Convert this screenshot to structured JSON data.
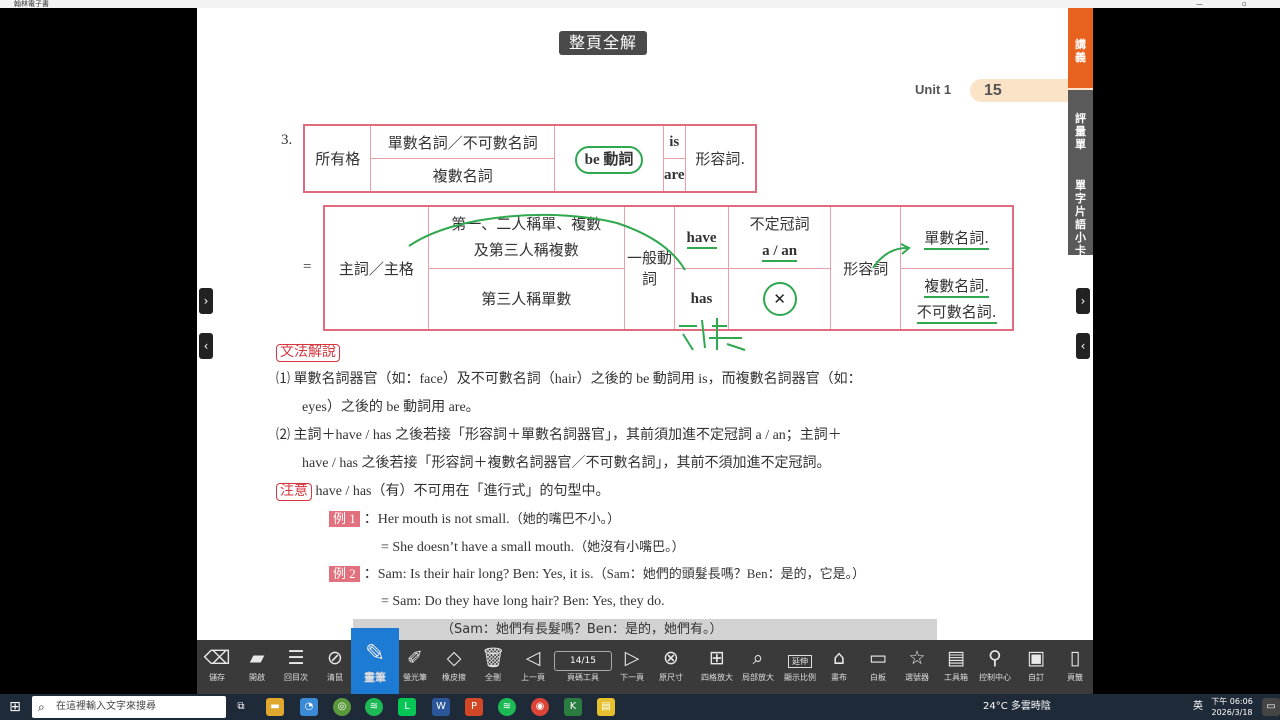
{
  "window": {
    "title": "翰林電子書"
  },
  "page": {
    "full_solution_label": "整頁全解",
    "unit_label": "Unit 1",
    "page_number": "15"
  },
  "side_tabs": {
    "handout": "講義",
    "evaluation": "評量單",
    "cards": "單字片語小卡"
  },
  "table1": {
    "number": "3.",
    "subject": "所有格",
    "row1": "單數名詞／不可數名詞",
    "row2": "複數名詞",
    "be_verb": "be 動詞",
    "is": "is",
    "are": "are",
    "adjective": "形容詞."
  },
  "table2": {
    "equals": "=",
    "subject": "主詞／主格",
    "group1_line1": "第一、二人稱單、複數",
    "group1_line2": "及第三人稱複數",
    "group2": "第三人稱單數",
    "general_verb": "一般動詞",
    "have": "have",
    "has": "has",
    "indef_header": "不定冠詞",
    "a_an": "a / an",
    "cross": "✕",
    "adjective": "形容詞",
    "singular_noun": "單數名詞.",
    "plural_noun": "複數名詞.",
    "uncountable_noun": "不可數名詞."
  },
  "explanation": {
    "tag": "文法解說",
    "p1_num": "⑴",
    "p1_line1": "單數名詞器官（如：face）及不可數名詞（hair）之後的 be 動詞用 is，而複數名詞器官（如：",
    "p1_line2": "eyes）之後的 be 動詞用 are。",
    "p2_num": "⑵",
    "p2_line1": "主詞＋have / has 之後若接「形容詞＋單數名詞器官」，其前須加進不定冠詞 a / an；主詞＋",
    "p2_line2": "have / has 之後若接「形容詞＋複數名詞器官／不可數名詞」，其前不須加進不定冠詞。"
  },
  "note": {
    "tag": "注意",
    "text": "have / has（有）不可用在「進行式」的句型中。"
  },
  "examples": [
    {
      "tag": "例 1",
      "en": "：Her mouth is not small.",
      "zh": "（她的嘴巴不小。）"
    },
    {
      "tag": "",
      "en": "= She doesn’t have a small mouth.",
      "zh": "（她沒有小嘴巴。）"
    },
    {
      "tag": "例 2",
      "en": "：Sam: Is their hair long?  Ben: Yes, it is.",
      "zh": "（Sam：她們的頭髮長嗎？Ben：是的，它是。）"
    },
    {
      "tag": "",
      "en": "= Sam: Do they have long hair?  Ben: Yes, they do.",
      "zh": ""
    }
  ],
  "overlay_text": "（Sam：她們有長髮嗎？Ben：是的，她們有。）",
  "toolbar": {
    "items": [
      {
        "label": "儲存",
        "icon": "eraser-icon"
      },
      {
        "label": "開啟",
        "icon": "folder-icon"
      },
      {
        "label": "回目次",
        "icon": "list-icon"
      },
      {
        "label": "清鼠",
        "icon": "clear-icon"
      },
      {
        "label": "畫筆",
        "icon": "pen-icon"
      },
      {
        "label": "螢光筆",
        "icon": "highlighter-icon"
      },
      {
        "label": "橡皮擦",
        "icon": "eraser-icon"
      },
      {
        "label": "全刪",
        "icon": "trash-icon"
      },
      {
        "label": "上一頁",
        "icon": "prev-icon"
      },
      {
        "label": "頁碼工具",
        "icon": "page-icon"
      },
      {
        "label": "下一頁",
        "icon": "next-icon"
      },
      {
        "label": "原尺寸",
        "icon": "zoom-reset-icon"
      },
      {
        "label": "四格放大",
        "icon": "grid-icon"
      },
      {
        "label": "局部放大",
        "icon": "zoom-area-icon"
      },
      {
        "label": "顯示比例",
        "icon": "ratio-icon"
      },
      {
        "label": "畫布",
        "icon": "canvas-icon"
      },
      {
        "label": "白板",
        "icon": "whiteboard-icon"
      },
      {
        "label": "選號器",
        "icon": "star-icon"
      },
      {
        "label": "工具箱",
        "icon": "toolbox-icon"
      },
      {
        "label": "控制中心",
        "icon": "control-icon"
      },
      {
        "label": "自訂",
        "icon": "custom-icon"
      },
      {
        "label": "頁籤",
        "icon": "bookmark-icon"
      }
    ],
    "page_indicator": "14/15",
    "ratio_badge": "延伸"
  },
  "taskbar": {
    "search_placeholder": "在這裡輸入文字來搜尋",
    "weather": "24°C  多雲時陰",
    "lang": "英",
    "time": "下午 06:06",
    "date": "2026/3/18"
  },
  "colors": {
    "accent_orange": "#e8621f",
    "table_border": "#e06b7c",
    "annotation_green": "#2fa84f",
    "toolbar_bg": "#3a3a3a",
    "pen_active": "#1e7bd4"
  }
}
